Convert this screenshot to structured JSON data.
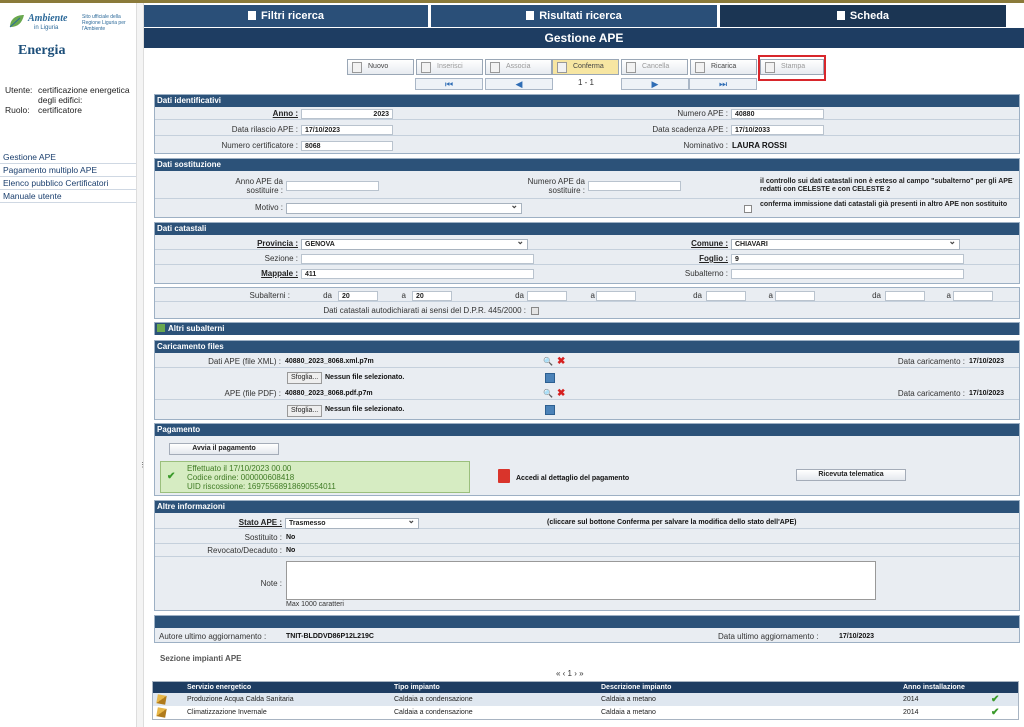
{
  "sidebar": {
    "logo_main": "Ambiente",
    "logo_sub": "in Liguria",
    "logo_note": "Sito ufficiale della Regione Liguria per l'Ambiente",
    "section": "Energia",
    "user_label": "Utente:",
    "user_value": "certificazione energetica degli edifici:",
    "role_label": "Ruolo:",
    "role_value": "certificatore",
    "menu": [
      "Gestione APE",
      "Pagamento multiplo APE",
      "Elenco pubblico Certificatori",
      "Manuale utente"
    ]
  },
  "tabs": [
    "Filtri ricerca",
    "Risultati ricerca",
    "Scheda"
  ],
  "page_title": "Gestione APE",
  "toolbar": {
    "buttons": [
      "Nuovo",
      "Inserisci",
      "Associa",
      "Conferma",
      "Cancella",
      "Ricarica",
      "Stampa"
    ],
    "pager": "1 - 1",
    "nav": [
      "⏮",
      "◀",
      "▶",
      "⏭"
    ]
  },
  "dati_identificativi": {
    "header": "Dati identificativi",
    "anno_label": "Anno :",
    "anno": "2023",
    "numero_ape_label": "Numero APE :",
    "numero_ape": "40880",
    "data_rilascio_label": "Data rilascio APE :",
    "data_rilascio": "17/10/2023",
    "data_scadenza_label": "Data scadenza APE :",
    "data_scadenza": "17/10/2033",
    "numero_cert_label": "Numero certificatore :",
    "numero_cert": "8068",
    "nominativo_label": "Nominativo :",
    "nominativo": "LAURA ROSSI"
  },
  "dati_sostituzione": {
    "header": "Dati sostituzione",
    "anno_label": "Anno APE da sostituire :",
    "numero_label": "Numero APE da sostituire :",
    "info": "il controllo sui dati catastali non è esteso al campo \"subalterno\" per gli APE redatti con CELESTE e con CELESTE 2",
    "motivo_label": "Motivo :",
    "conferma_text": "conferma immissione dati catastali già presenti in altro APE non sostituito"
  },
  "dati_catastali": {
    "header": "Dati catastali",
    "provincia_label": "Provincia :",
    "provincia": "GENOVA",
    "comune_label": "Comune :",
    "comune": "CHIAVARI",
    "sezione_label": "Sezione :",
    "foglio_label": "Foglio :",
    "foglio": "9",
    "mappale_label": "Mappale :",
    "mappale": "411",
    "subalterno_label": "Subalterno :",
    "subalterni_label": "Subalterni :",
    "da": "da",
    "a": "a",
    "sub_da": "20",
    "sub_a": "20",
    "autodich": "Dati catastali autodichiarati ai sensi del D.P.R. 445/2000 :"
  },
  "altri_subalterni": "Altri subalterni",
  "caricamento": {
    "header": "Caricamento files",
    "xml_label": "Dati APE (file XML) :",
    "xml_file": "40880_2023_8068.xml.p7m",
    "pdf_label": "APE (file PDF) :",
    "pdf_file": "40880_2023_8068.pdf.p7m",
    "browse": "Sfoglia...",
    "no_file": "Nessun file selezionato.",
    "data_label": "Data caricamento :",
    "data_xml": "17/10/2023",
    "data_pdf": "17/10/2023"
  },
  "pagamento": {
    "header": "Pagamento",
    "avvia": "Avvia il pagamento",
    "line1": "Effettuato il 17/10/2023 00.00",
    "line2": "Codice ordine: 000000608418",
    "line3": "UID riscossione: 16975568918690554011",
    "dettaglio": "Accedi al dettaglio del pagamento",
    "ricevuta": "Ricevuta telematica"
  },
  "altre_info": {
    "header": "Altre informazioni",
    "stato_label": "Stato APE :",
    "stato": "Trasmesso",
    "stato_hint": "(cliccare sul bottone Conferma per salvare la modifica dello stato dell'APE)",
    "sostituito_label": "Sostituito :",
    "sostituito": "No",
    "revocato_label": "Revocato/Decaduto :",
    "revocato": "No",
    "note_label": "Note :",
    "max": "Max 1000 caratteri"
  },
  "footer_info": {
    "autore_label": "Autore ultimo aggiornamento :",
    "autore": "TNIT-BLDDVD86P12L219C",
    "data_label": "Data ultimo aggiornamento :",
    "data": "17/10/2023"
  },
  "impianti": {
    "title": "Sezione impianti APE",
    "pager": "« ‹ 1 › »",
    "columns": [
      "Servizio energetico",
      "Tipo impianto",
      "Descrizione impianto",
      "Anno installazione"
    ],
    "rows": [
      [
        "Produzione Acqua Calda Sanitaria",
        "Caldaia a condensazione",
        "Caldaia a metano",
        "2014"
      ],
      [
        "Climatizzazione Invernale",
        "Caldaia a condensazione",
        "Caldaia a metano",
        "2014"
      ]
    ]
  }
}
